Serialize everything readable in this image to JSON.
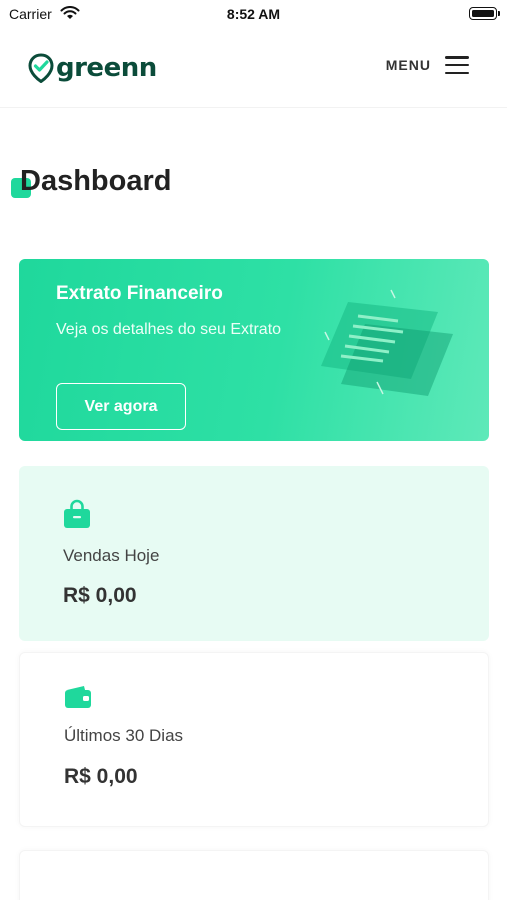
{
  "status_bar": {
    "carrier": "Carrier",
    "time": "8:52 AM"
  },
  "header": {
    "logo_text": "greenn",
    "menu_label": "MENU"
  },
  "page": {
    "title": "Dashboard"
  },
  "colors": {
    "accent": "#1fd89c",
    "dark_green": "#0b4c3a",
    "card_tint": "#e7fbf3"
  },
  "banner": {
    "title": "Extrato Financeiro",
    "description": "Veja os detalhes do seu Extrato",
    "button_label": "Ver agora"
  },
  "cards": [
    {
      "icon": "shopping-bag-icon",
      "label": "Vendas Hoje",
      "value": "R$ 0,00"
    },
    {
      "icon": "wallet-icon",
      "label": "Últimos 30 Dias",
      "value": "R$ 0,00"
    }
  ]
}
